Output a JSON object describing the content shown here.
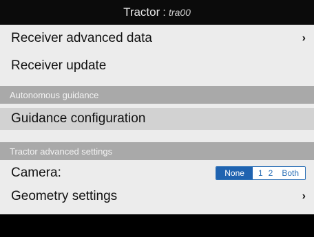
{
  "titlebar": {
    "title": "Tractor",
    "separator": ":",
    "subtitle": "tra00"
  },
  "menu": {
    "receiver_advanced": "Receiver advanced data",
    "receiver_update": "Receiver update",
    "section_autonomous": "Autonomous guidance",
    "guidance_config": "Guidance configuration",
    "section_tractor": "Tractor advanced settings",
    "camera_label": "Camera:",
    "camera_options": {
      "none": "None",
      "one": "1",
      "two": "2",
      "both": "Both"
    },
    "camera_selected": "None",
    "geometry": "Geometry settings",
    "chevron": "›"
  },
  "colors": {
    "accent": "#1f63b0",
    "section_bg": "#a9a9a9",
    "highlight_bg": "#d2d2d2"
  }
}
